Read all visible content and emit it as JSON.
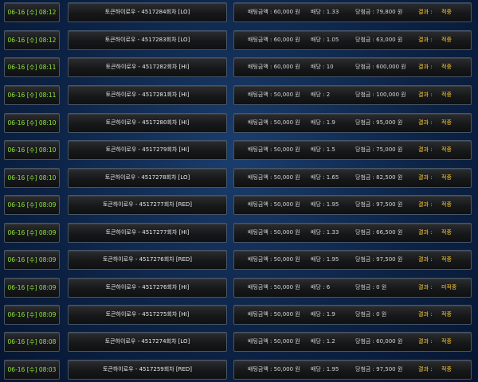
{
  "rows": [
    {
      "time": "06-16 [수] 08:12",
      "game": "토큰하이로우 - 4517284회차 [LO]",
      "bet": "배팅금액 : 60,000 원",
      "odds": "배당 : 1.33",
      "win": "당첨금 : 79,800 원",
      "result_label": "결과 :",
      "result": "적중"
    },
    {
      "time": "06-16 [수] 08:12",
      "game": "토큰하이로우 - 4517283회차 [LO]",
      "bet": "배팅금액 : 60,000 원",
      "odds": "배당 : 1.05",
      "win": "당첨금 : 63,000 원",
      "result_label": "결과 :",
      "result": "적중"
    },
    {
      "time": "06-16 [수] 08:11",
      "game": "토큰하이로우 - 4517282회차 [HI]",
      "bet": "배팅금액 : 60,000 원",
      "odds": "배당 : 10",
      "win": "당첨금 : 600,000 원",
      "result_label": "결과 :",
      "result": "적중"
    },
    {
      "time": "06-16 [수] 08:11",
      "game": "토큰하이로우 - 4517281회차 [HI]",
      "bet": "배팅금액 : 50,000 원",
      "odds": "배당 : 2",
      "win": "당첨금 : 100,000 원",
      "result_label": "결과 :",
      "result": "적중"
    },
    {
      "time": "06-16 [수] 08:10",
      "game": "토큰하이로우 - 4517280회차 [HI]",
      "bet": "배팅금액 : 50,000 원",
      "odds": "배당 : 1.9",
      "win": "당첨금 : 95,000 원",
      "result_label": "결과 :",
      "result": "적중"
    },
    {
      "time": "06-16 [수] 08:10",
      "game": "토큰하이로우 - 4517279회차 [HI]",
      "bet": "배팅금액 : 50,000 원",
      "odds": "배당 : 1.5",
      "win": "당첨금 : 75,000 원",
      "result_label": "결과 :",
      "result": "적중"
    },
    {
      "time": "06-16 [수] 08:10",
      "game": "토큰하이로우 - 4517278회차 [LO]",
      "bet": "배팅금액 : 50,000 원",
      "odds": "배당 : 1.65",
      "win": "당첨금 : 82,500 원",
      "result_label": "결과 :",
      "result": "적중"
    },
    {
      "time": "06-16 [수] 08:09",
      "game": "토큰하이로우 - 4517277회차 [RED]",
      "bet": "배팅금액 : 50,000 원",
      "odds": "배당 : 1.95",
      "win": "당첨금 : 97,500 원",
      "result_label": "결과 :",
      "result": "적중"
    },
    {
      "time": "06-16 [수] 08:09",
      "game": "토큰하이로우 - 4517277회차 [HI]",
      "bet": "배팅금액 : 50,000 원",
      "odds": "배당 : 1.33",
      "win": "당첨금 : 66,500 원",
      "result_label": "결과 :",
      "result": "적중"
    },
    {
      "time": "06-16 [수] 08:09",
      "game": "토큰하이로우 - 4517276회차 [RED]",
      "bet": "배팅금액 : 50,000 원",
      "odds": "배당 : 1.95",
      "win": "당첨금 : 97,500 원",
      "result_label": "결과 :",
      "result": "적중"
    },
    {
      "time": "06-16 [수] 08:09",
      "game": "토큰하이로우 - 4517276회차 [HI]",
      "bet": "배팅금액 : 50,000 원",
      "odds": "배당 : 6",
      "win": "당첨금 : 0 원",
      "result_label": "결과 :",
      "result": "미적중"
    },
    {
      "time": "06-16 [수] 08:09",
      "game": "토큰하이로우 - 4517275회차 [HI]",
      "bet": "배팅금액 : 50,000 원",
      "odds": "배당 : 1.9",
      "win": "당첨금 : 0 원",
      "result_label": "결과 :",
      "result": "적중"
    },
    {
      "time": "06-16 [수] 08:08",
      "game": "토큰하이로우 - 4517274회차 [LO]",
      "bet": "배팅금액 : 50,000 원",
      "odds": "배당 : 1.2",
      "win": "당첨금 : 60,000 원",
      "result_label": "결과 :",
      "result": "적중"
    },
    {
      "time": "06-16 [수] 08:03",
      "game": "토큰하이로우 - 4517259회차 [RED]",
      "bet": "배팅금액 : 50,000 원",
      "odds": "배당 : 1.95",
      "win": "당첨금 : 97,500 원",
      "result_label": "결과 :",
      "result": "적중"
    }
  ]
}
